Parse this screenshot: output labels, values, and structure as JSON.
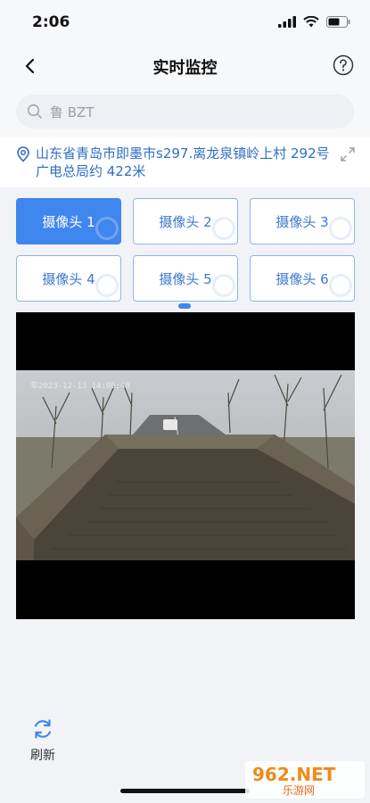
{
  "status_bar": {
    "time": "2:06"
  },
  "nav": {
    "title": "实时监控"
  },
  "search": {
    "value": "鲁 BZT"
  },
  "location": {
    "text": "山东省青岛市即墨市s297.离龙泉镇岭上村 292号广电总局约 422米"
  },
  "cameras": [
    {
      "label": "摄像头 1",
      "active": true
    },
    {
      "label": "摄像头 2",
      "active": false
    },
    {
      "label": "摄像头 3",
      "active": false
    },
    {
      "label": "摄像头 4",
      "active": false
    },
    {
      "label": "摄像头 5",
      "active": false
    },
    {
      "label": "摄像头 6",
      "active": false
    }
  ],
  "video": {
    "osd_time": "年2023-12-13 14:06:40"
  },
  "refresh": {
    "label": "刷新"
  },
  "watermark": {
    "text": "962.NET",
    "subtext": "乐游网"
  },
  "colors": {
    "accent": "#3f86ee",
    "location": "#2e6fc4"
  }
}
